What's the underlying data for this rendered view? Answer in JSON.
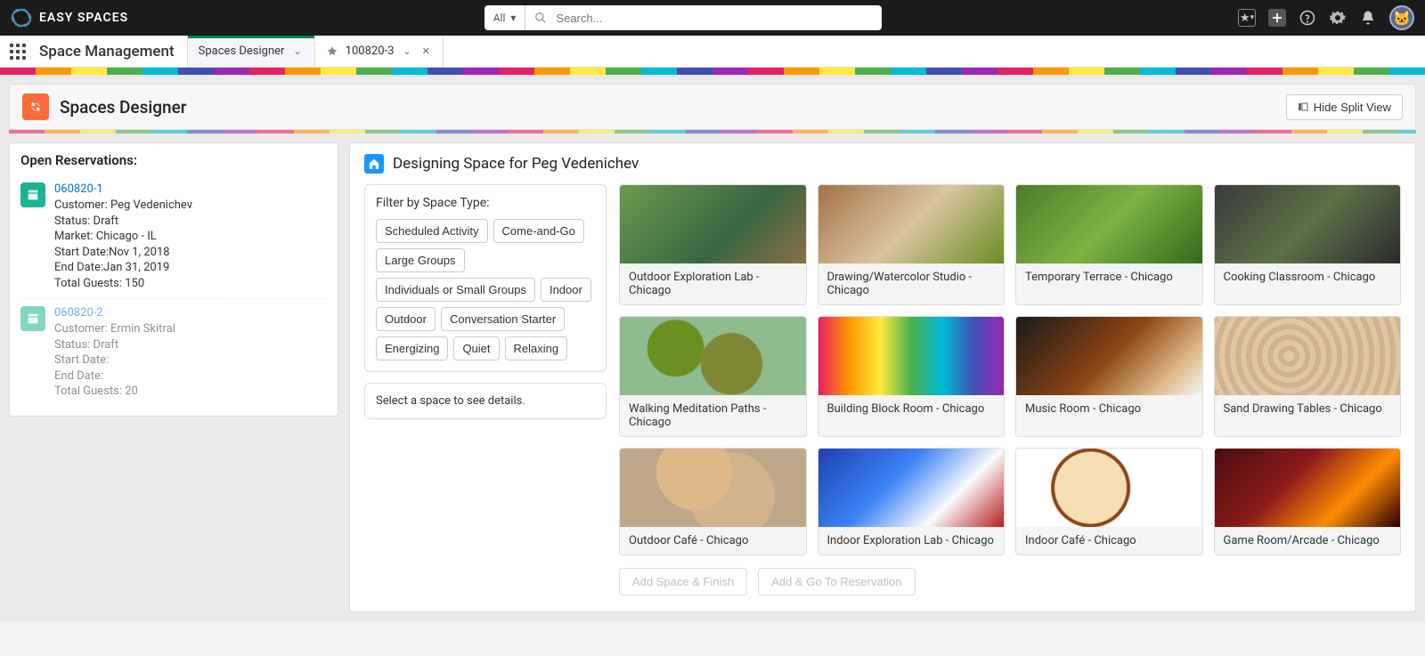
{
  "header": {
    "brand": "EASY SPACES",
    "search_scope": "All",
    "search_placeholder": "Search..."
  },
  "nav": {
    "app_name": "Space Management",
    "tabs": [
      {
        "label": "Spaces Designer",
        "active": true,
        "closable": false
      },
      {
        "label": "100820-3",
        "active": false,
        "closable": true
      }
    ]
  },
  "page": {
    "title": "Spaces Designer",
    "split_button": "Hide Split View"
  },
  "sidebar": {
    "title": "Open Reservations:",
    "reservations": [
      {
        "id": "060820-1",
        "customer_label": "Customer: ",
        "customer": "Peg Vedenichev",
        "status_label": "Status: ",
        "status": "Draft",
        "market_label": "Market: ",
        "market": "Chicago - IL",
        "start_label": "Start Date:",
        "start": "Nov 1, 2018",
        "end_label": "End Date:",
        "end": "Jan 31, 2019",
        "guests_label": "Total Guests: ",
        "guests": "150",
        "faded": false
      },
      {
        "id": "060820-2",
        "customer_label": "Customer: ",
        "customer": "Ermin Skitral",
        "status_label": "Status: ",
        "status": "Draft",
        "market_label": "",
        "market": "",
        "start_label": "Start Date:",
        "start": "",
        "end_label": "End Date:",
        "end": "",
        "guests_label": "Total Guests: ",
        "guests": "20",
        "faded": true
      }
    ]
  },
  "main": {
    "title": "Designing Space for Peg Vedenichev",
    "filter_title": "Filter by Space Type:",
    "filters": [
      "Scheduled Activity",
      "Come-and-Go",
      "Large Groups",
      "Individuals or Small Groups",
      "Indoor",
      "Outdoor",
      "Conversation Starter",
      "Energizing",
      "Quiet",
      "Relaxing"
    ],
    "detail_hint": "Select a space to see details.",
    "spaces": [
      "Outdoor Exploration Lab - Chicago",
      "Drawing/Watercolor Studio - Chicago",
      "Temporary Terrace - Chicago",
      "Cooking Classroom - Chicago",
      "Walking Meditation Paths - Chicago",
      "Building Block Room - Chicago",
      "Music Room - Chicago",
      "Sand Drawing Tables - Chicago",
      "Outdoor Café - Chicago",
      "Indoor Exploration Lab - Chicago",
      "Indoor Café - Chicago",
      "Game Room/Arcade - Chicago"
    ],
    "actions": {
      "add_finish": "Add Space & Finish",
      "add_go": "Add & Go To Reservation"
    }
  }
}
